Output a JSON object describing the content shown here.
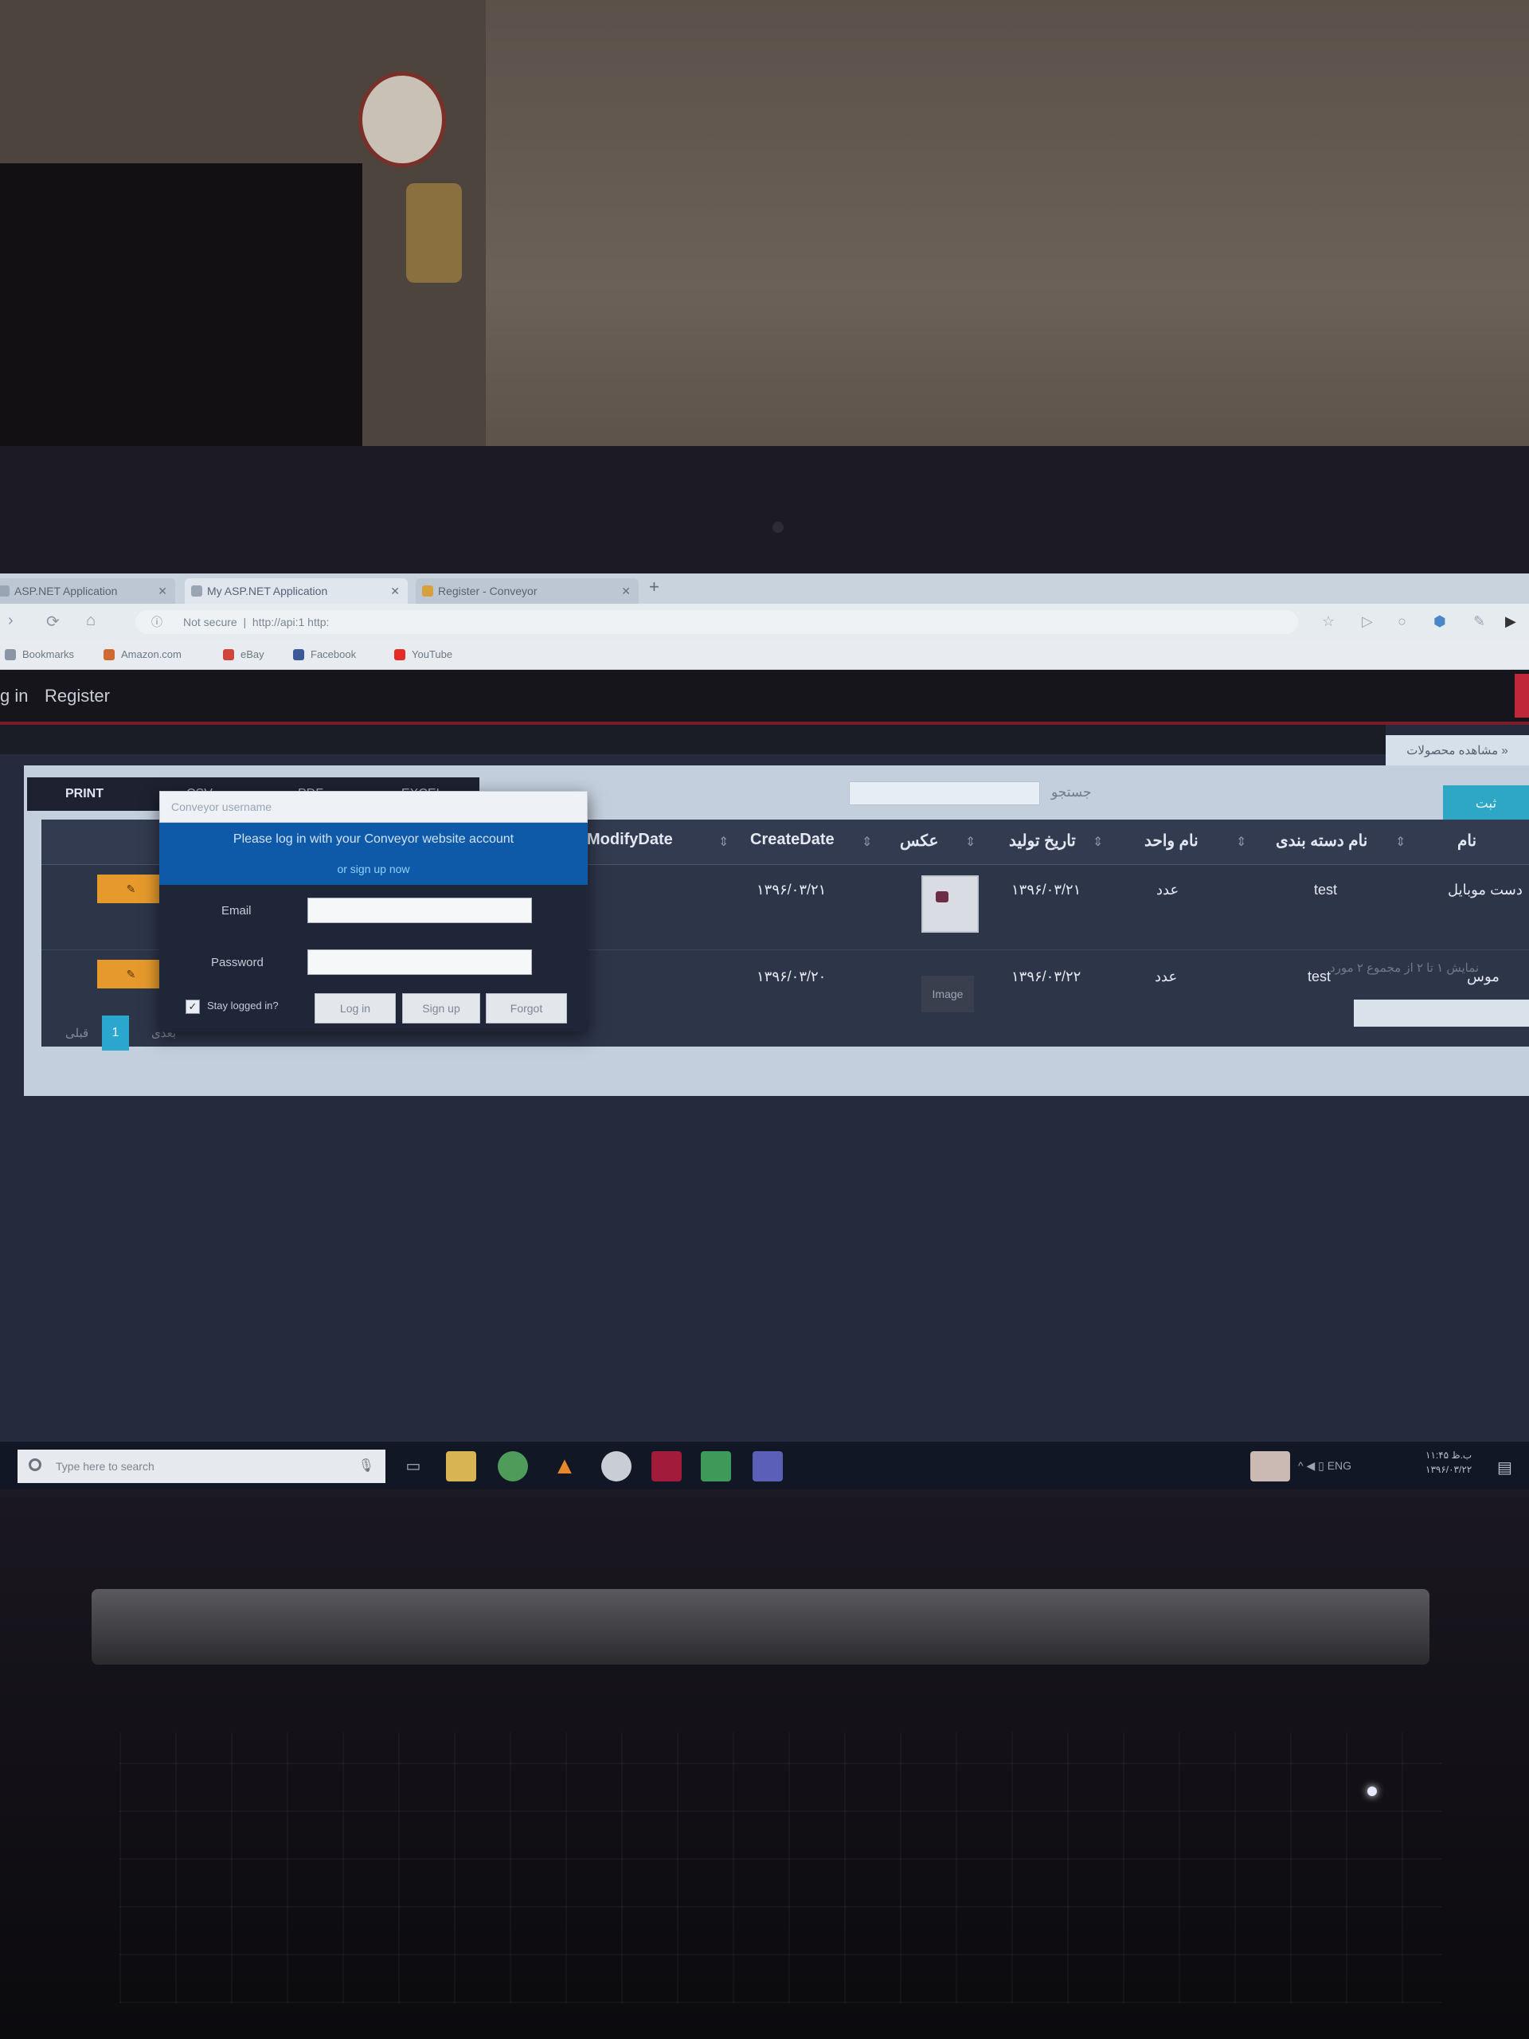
{
  "browser": {
    "tabs": [
      {
        "title": "ASP.NET Application"
      },
      {
        "title": "My ASP.NET Application"
      },
      {
        "title": "Register - Conveyor"
      }
    ],
    "address": "http://api:1 http:",
    "address_prefix": "Not secure",
    "bookmarks": [
      {
        "label": "Bookmarks",
        "color": "#8a96a5"
      },
      {
        "label": "Amazon.com",
        "color": "#cf6a32"
      },
      {
        "label": "eBay",
        "color": "#d0453b"
      },
      {
        "label": "Facebook",
        "color": "#3b5998"
      },
      {
        "label": "YouTube",
        "color": "#e52d27"
      }
    ]
  },
  "navbar": {
    "login_link": "g in",
    "register_link": "Register"
  },
  "page_tab": "مشاهده محصولات »",
  "toolbar": {
    "buttons": [
      "PRINT",
      "CSV",
      "PDF",
      "EXCEL"
    ],
    "search_label": "جستجو",
    "apply_label": "ثبت"
  },
  "grid": {
    "columns": {
      "name": "نام",
      "category": "نام دسته بندی",
      "unit": "نام واحد",
      "production_date": "تاریخ تولید",
      "photo": "عکس",
      "create_date": "CreateDate",
      "modify_date": "ModifyDate"
    },
    "rows": [
      {
        "name": "دست موبایل",
        "category": "test",
        "unit": "عدد",
        "production_date": "۱۳۹۶/۰۳/۲۱",
        "photo": "thumbnail",
        "create_date": "۱۳۹۶/۰۳/۲۱",
        "action": "✎"
      },
      {
        "name": "موس",
        "category": "test",
        "unit": "عدد",
        "production_date": "۱۳۹۶/۰۳/۲۲",
        "photo_text": "Image",
        "create_date": "۱۳۹۶/۰۳/۲۰",
        "action": "✎"
      }
    ]
  },
  "summary": "نمایش ۱ تا ۲ از مجموع ۲ مورد",
  "pager": {
    "prev": "قبلی",
    "current": "1",
    "next": "بعدی"
  },
  "login_popup": {
    "top_input_placeholder": "Conveyor username",
    "message": "Please log in with your Conveyor website account",
    "sub_link": "or sign up now",
    "email_label": "Email",
    "password_label": "Password",
    "remember_label": "Stay logged in?",
    "remember_checked": true,
    "buttons": [
      "Log in",
      "Sign up",
      "Forgot"
    ]
  },
  "taskbar": {
    "search_placeholder": "Type here to search",
    "tray_text": "^ ◀ ▯ ENG",
    "clock_time": "۱۱:۴۵ ب.ظ",
    "clock_date": "۱۳۹۶/۰۳/۲۲"
  }
}
